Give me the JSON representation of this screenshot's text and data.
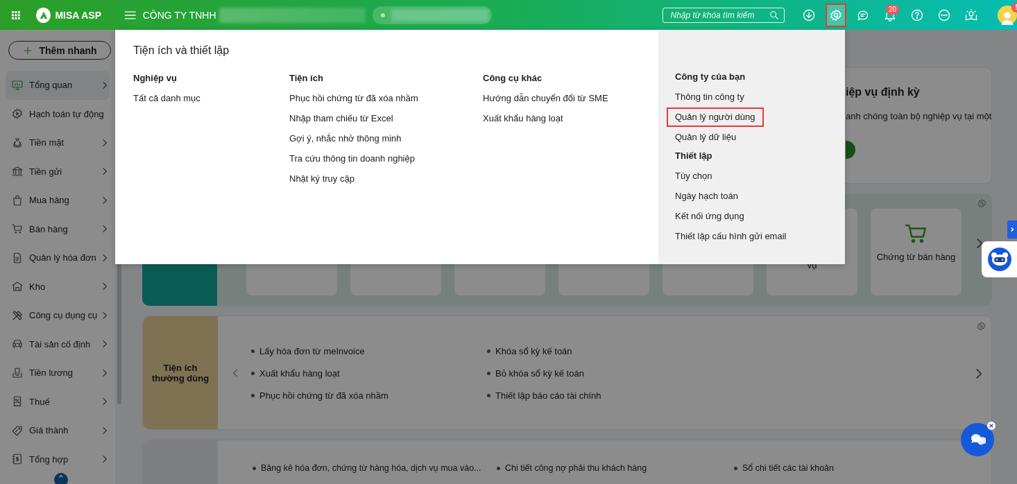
{
  "topbar": {
    "app_name": "MISA ASP",
    "company_label": "CÔNG TY TNHH",
    "search": {
      "placeholder": "Nhập từ khóa tìm kiếm"
    },
    "icons": [
      {
        "kind": "download",
        "highlighted": false
      },
      {
        "kind": "settings",
        "highlighted": true
      },
      {
        "kind": "chat",
        "highlighted": false
      },
      {
        "kind": "bell",
        "highlighted": false,
        "badge": "20"
      },
      {
        "kind": "help",
        "highlighted": false
      },
      {
        "kind": "more",
        "highlighted": false
      },
      {
        "kind": "idea",
        "highlighted": false
      }
    ],
    "avatar_badge": "!"
  },
  "sidebar": {
    "quick_add": "Thêm nhanh",
    "items": [
      {
        "label": "Tổng quan",
        "selected": true,
        "has_submenu": true
      },
      {
        "label": "Hạch toán tự động",
        "selected": false,
        "has_submenu": false
      },
      {
        "label": "Tiền mặt",
        "selected": false,
        "has_submenu": true
      },
      {
        "label": "Tiền gửi",
        "selected": false,
        "has_submenu": true
      },
      {
        "label": "Mua hàng",
        "selected": false,
        "has_submenu": true
      },
      {
        "label": "Bán hàng",
        "selected": false,
        "has_submenu": true
      },
      {
        "label": "Quản lý hóa đơn",
        "selected": false,
        "has_submenu": true
      },
      {
        "label": "Kho",
        "selected": false,
        "has_submenu": true
      },
      {
        "label": "Công cụ dụng cụ",
        "selected": false,
        "has_submenu": true
      },
      {
        "label": "Tài sản cố định",
        "selected": false,
        "has_submenu": true
      },
      {
        "label": "Tiền lương",
        "selected": false,
        "has_submenu": true
      },
      {
        "label": "Thuế",
        "selected": false,
        "has_submenu": true
      },
      {
        "label": "Giá thành",
        "selected": false,
        "has_submenu": true
      },
      {
        "label": "Tổng hợp",
        "selected": false,
        "has_submenu": true
      }
    ]
  },
  "main": {
    "periodic_card": {
      "title": "iệp vụ định kỳ",
      "text": "anh chóng toàn bộ nghiệp vụ tại một"
    },
    "shortcuts": {
      "tiles": [
        {
          "label": "vụ"
        },
        {
          "label": "Chứng từ bán hàng"
        }
      ]
    },
    "favorites": {
      "title": "Tiện ích thường dùng",
      "items": [
        "Lấy hóa đơn từ meInvoice",
        "Xuất khẩu hàng loạt",
        "Phục hồi chứng từ đã xóa nhầm",
        "Khóa sổ kỳ kế toán",
        "Bỏ khóa sổ kỳ kế toán",
        "Thiết lập báo cáo tài chính"
      ]
    },
    "reports": {
      "items": [
        "Bảng kê hóa đơn, chứng từ hàng hóa, dịch vụ mua vào...",
        "Chi tiết công nợ phải thu khách hàng",
        "Sổ chi tiết các tài khoản"
      ]
    }
  },
  "menu": {
    "title": "Tiện ích và thiết lập",
    "columns": [
      {
        "sections": [
          {
            "heading": "Nghiệp vụ",
            "items": [
              {
                "label": "Tất cả danh mục",
                "highlighted": false
              }
            ]
          }
        ]
      },
      {
        "sections": [
          {
            "heading": "Tiện ích",
            "items": [
              {
                "label": "Phục hồi chứng từ đã xóa nhầm",
                "highlighted": false
              },
              {
                "label": "Nhập tham chiếu từ Excel",
                "highlighted": false
              },
              {
                "label": "Gợi ý, nhắc nhở thông minh",
                "highlighted": false
              },
              {
                "label": "Tra cứu thông tin doanh nghiệp",
                "highlighted": false
              },
              {
                "label": "Nhật ký truy cập",
                "highlighted": false
              }
            ]
          }
        ]
      },
      {
        "sections": [
          {
            "heading": "Công cụ khác",
            "items": [
              {
                "label": "Hướng dẫn chuyển đổi từ SME",
                "highlighted": false
              },
              {
                "label": "Xuất khẩu hàng loạt",
                "highlighted": false
              }
            ]
          }
        ]
      }
    ],
    "side_column": {
      "sections": [
        {
          "heading": "Công ty của bạn",
          "items": [
            {
              "label": "Thông tin công ty",
              "highlighted": false
            },
            {
              "label": "Quản lý người dùng",
              "highlighted": true
            },
            {
              "label": "Quản lý dữ liệu",
              "highlighted": false
            }
          ]
        },
        {
          "heading": "Thiết lập",
          "items": [
            {
              "label": "Tùy chọn",
              "highlighted": false
            },
            {
              "label": "Ngày hạch toán",
              "highlighted": false
            },
            {
              "label": "Kết nối ứng dụng",
              "highlighted": false
            },
            {
              "label": "Thiết lập cấu hình gửi email",
              "highlighted": false
            }
          ]
        }
      ]
    }
  }
}
